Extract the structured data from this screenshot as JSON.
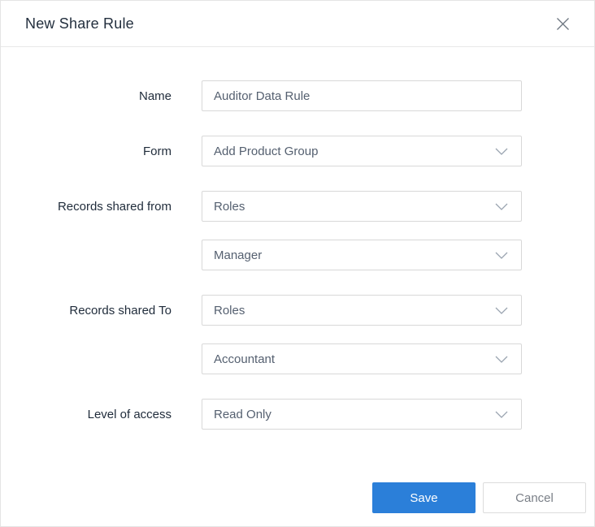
{
  "modal": {
    "title": "New Share Rule"
  },
  "fields": {
    "name": {
      "label": "Name",
      "value": "Auditor Data Rule"
    },
    "form": {
      "label": "Form",
      "value": "Add Product Group"
    },
    "records_shared_from": {
      "label": "Records shared from",
      "value": "Roles",
      "sub_value": "Manager"
    },
    "records_shared_to": {
      "label": "Records shared To",
      "value": "Roles",
      "sub_value": "Accountant"
    },
    "level_of_access": {
      "label": "Level of access",
      "value": "Read Only"
    }
  },
  "footer": {
    "save_label": "Save",
    "cancel_label": "Cancel"
  },
  "colors": {
    "accent": "#2b7fd9",
    "title_text": "#232f3e",
    "input_border": "#d8d8d8"
  }
}
